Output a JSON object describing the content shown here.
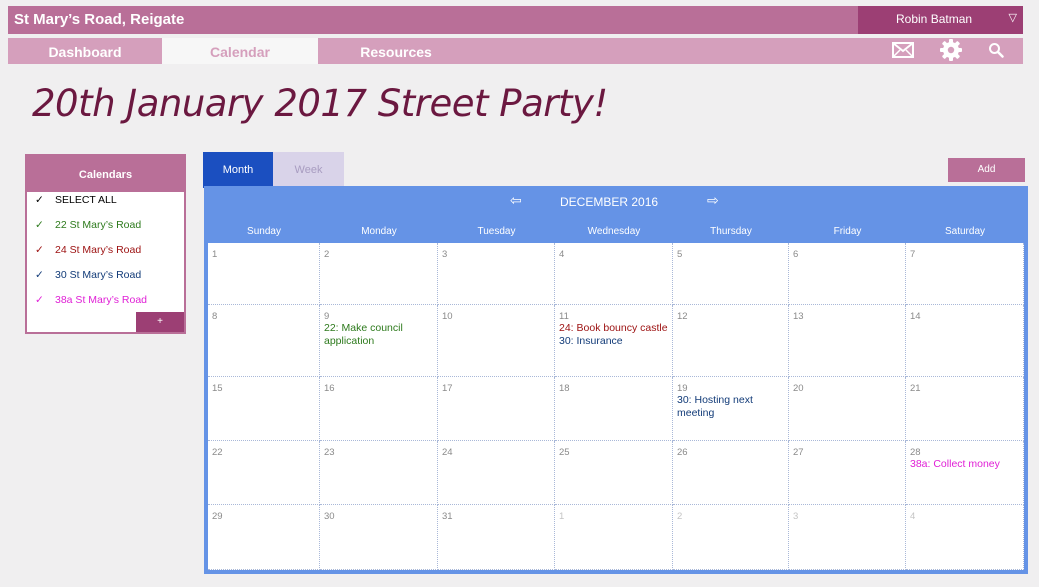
{
  "header": {
    "site_title": "St Mary’s Road, Reigate",
    "user_name": "Robin Batman",
    "user_caret": "▽"
  },
  "nav": {
    "tabs": [
      {
        "label": "Dashboard"
      },
      {
        "label": "Calendar"
      },
      {
        "label": "Resources"
      }
    ],
    "icons": [
      "mail-icon",
      "gear-icon",
      "search-icon"
    ]
  },
  "page": {
    "title": "20th January 2017 Street Party!"
  },
  "calendars_panel": {
    "title": "Calendars",
    "items": [
      {
        "check": "✓",
        "label": "SELECT ALL",
        "color": "#000000"
      },
      {
        "check": "✓",
        "label": "22 St Mary’s Road",
        "color": "#2d7a1c"
      },
      {
        "check": "✓",
        "label": "24 St Mary’s Road",
        "color": "#9c1010"
      },
      {
        "check": "✓",
        "label": "30 St Mary’s Road",
        "color": "#123b78"
      },
      {
        "check": "✓",
        "label": "38a  St Mary’s Road",
        "color": "#e020d6"
      }
    ],
    "add_label": "+"
  },
  "views": {
    "month_label": "Month",
    "week_label": "Week",
    "add_label": "Add"
  },
  "calendar": {
    "prev_arrow": "⇦",
    "month_label": "DECEMBER 2016",
    "next_arrow": "⇨",
    "weekdays": [
      "Sunday",
      "Monday",
      "Tuesday",
      "Wednesday",
      "Thursday",
      "Friday",
      "Saturday"
    ],
    "weeks": [
      [
        {
          "day": "1",
          "other": false,
          "events": []
        },
        {
          "day": "2",
          "other": false,
          "events": []
        },
        {
          "day": "3",
          "other": false,
          "events": []
        },
        {
          "day": "4",
          "other": false,
          "events": []
        },
        {
          "day": "5",
          "other": false,
          "events": []
        },
        {
          "day": "6",
          "other": false,
          "events": []
        },
        {
          "day": "7",
          "other": false,
          "events": []
        }
      ],
      [
        {
          "day": "8",
          "other": false,
          "events": []
        },
        {
          "day": "9",
          "other": false,
          "events": [
            {
              "text": "22: Make council application",
              "color": "#2d7a1c"
            }
          ]
        },
        {
          "day": "10",
          "other": false,
          "events": []
        },
        {
          "day": "11",
          "other": false,
          "events": [
            {
              "text": "24: Book bouncy castle",
              "color": "#9c1010"
            },
            {
              "text": "30: Insurance",
              "color": "#123b78"
            }
          ]
        },
        {
          "day": "12",
          "other": false,
          "events": []
        },
        {
          "day": "13",
          "other": false,
          "events": []
        },
        {
          "day": "14",
          "other": false,
          "events": []
        }
      ],
      [
        {
          "day": "15",
          "other": false,
          "events": []
        },
        {
          "day": "16",
          "other": false,
          "events": []
        },
        {
          "day": "17",
          "other": false,
          "events": []
        },
        {
          "day": "18",
          "other": false,
          "events": []
        },
        {
          "day": "19",
          "other": false,
          "events": [
            {
              "text": "30:  Hosting next meeting",
              "color": "#123b78"
            }
          ]
        },
        {
          "day": "20",
          "other": false,
          "events": []
        },
        {
          "day": "21",
          "other": false,
          "events": []
        }
      ],
      [
        {
          "day": "22",
          "other": false,
          "events": []
        },
        {
          "day": "23",
          "other": false,
          "events": []
        },
        {
          "day": "24",
          "other": false,
          "events": []
        },
        {
          "day": "25",
          "other": false,
          "events": []
        },
        {
          "day": "26",
          "other": false,
          "events": []
        },
        {
          "day": "27",
          "other": false,
          "events": []
        },
        {
          "day": "28",
          "other": false,
          "events": [
            {
              "text": "38a: Collect money",
              "color": "#e020d6"
            }
          ]
        }
      ],
      [
        {
          "day": "29",
          "other": false,
          "events": []
        },
        {
          "day": "30",
          "other": false,
          "events": []
        },
        {
          "day": "31",
          "other": false,
          "events": []
        },
        {
          "day": "1",
          "other": true,
          "events": []
        },
        {
          "day": "2",
          "other": true,
          "events": []
        },
        {
          "day": "3",
          "other": true,
          "events": []
        },
        {
          "day": "4",
          "other": true,
          "events": []
        }
      ]
    ]
  },
  "colors": {
    "brand": "#b96f98",
    "brand_dark": "#9c3f74",
    "title": "#6b1840",
    "calendar_blue": "#6593e6",
    "month_button": "#1b4fc0"
  }
}
